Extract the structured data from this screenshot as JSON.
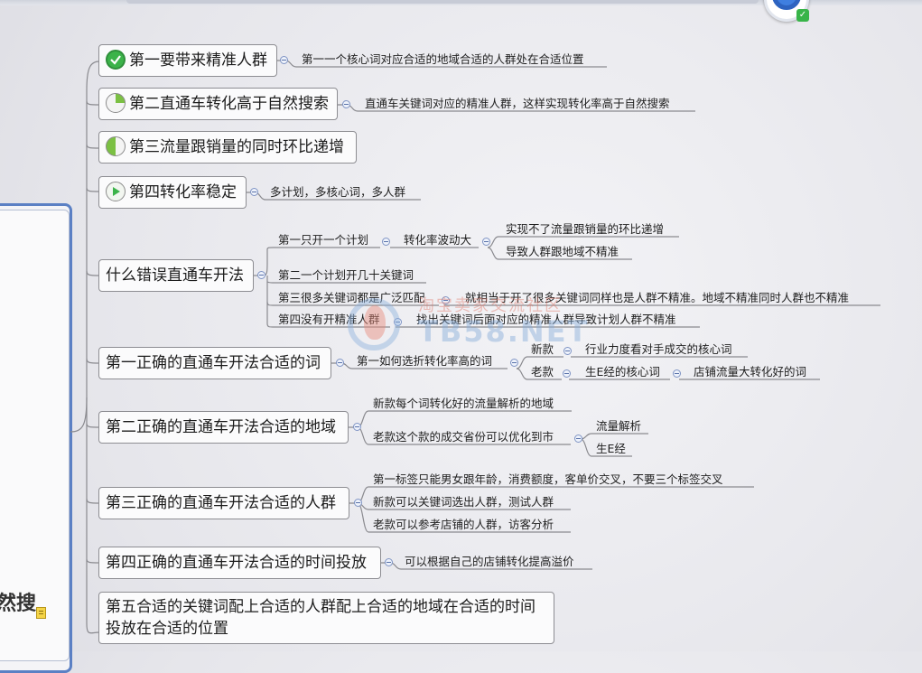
{
  "root": {
    "label_fragment": "然搜"
  },
  "branches": [
    {
      "id": "b1",
      "label": "第一要带来精准人群",
      "icon": "check-icon",
      "children": [
        {
          "label": "第一一个核心词对应合适的地域合适的人群处在合适位置"
        }
      ]
    },
    {
      "id": "b2",
      "label": "第二直通车转化高于自然搜索",
      "icon": "progress-quarter-icon",
      "children": [
        {
          "label": "直通车关键词对应的精准人群，这样实现转化率高于自然搜索"
        }
      ]
    },
    {
      "id": "b3",
      "label": "第三流量跟销量的同时环比递增",
      "icon": "progress-half-icon",
      "children": []
    },
    {
      "id": "b4",
      "label": "第四转化率稳定",
      "icon": "play-icon",
      "children": [
        {
          "label": "多计划，多核心词，多人群"
        }
      ]
    },
    {
      "id": "b5",
      "label": "什么错误直通车开法",
      "children": [
        {
          "label": "第一只开一个计划",
          "children": [
            {
              "label": "转化率波动大",
              "children": [
                {
                  "label": "实现不了流量跟销量的环比递增"
                },
                {
                  "label": "导致人群跟地域不精准"
                }
              ]
            }
          ]
        },
        {
          "label": "第二一个计划开几十关键词"
        },
        {
          "label": "第三很多关键词都是广泛匹配",
          "children": [
            {
              "label": "就相当于开了很多关键词同样也是人群不精准。地域不精准同时人群也不精准"
            }
          ]
        },
        {
          "label": "第四没有开精准人群",
          "children": [
            {
              "label": "找出关键词后面对应的精准人群导致计划人群不精准"
            }
          ]
        }
      ]
    },
    {
      "id": "b6",
      "label": "第一正确的直通车开法合适的词",
      "children": [
        {
          "label": "第一如何选折转化率高的词",
          "children": [
            {
              "label": "新款",
              "children": [
                {
                  "label": "行业力度看对手成交的核心词"
                }
              ]
            },
            {
              "label": "老款",
              "children": [
                {
                  "label": "生E经的核心词",
                  "children": [
                    {
                      "label": "店铺流量大转化好的词"
                    }
                  ]
                }
              ]
            }
          ]
        }
      ]
    },
    {
      "id": "b7",
      "label": "第二正确的直通车开法合适的地域",
      "children": [
        {
          "label": "新款每个词转化好的流量解析的地域"
        },
        {
          "label": "老款这个款的成交省份可以优化到市",
          "children": [
            {
              "label": "流量解析"
            },
            {
              "label": "生E经"
            }
          ]
        }
      ]
    },
    {
      "id": "b8",
      "label": "第三正确的直通车开法合适的人群",
      "children": [
        {
          "label": "第一标签只能男女跟年龄，消费额度，客单价交叉，不要三个标签交叉"
        },
        {
          "label": "新款可以关键词选出人群，测试人群"
        },
        {
          "label": "老款可以参考店铺的人群，访客分析"
        }
      ]
    },
    {
      "id": "b9",
      "label": "第四正确的直通车开法合适的时间投放",
      "children": [
        {
          "label": "可以根据自己的店铺转化提高溢价"
        }
      ]
    },
    {
      "id": "b10",
      "label": "第五合适的关键词配上合适的人群配上合适的地域在合适的时间",
      "label2": "投放在合适的位置",
      "children": []
    }
  ],
  "watermark": {
    "cn": "淘宝卖家交流社区",
    "en": "TB58.NET"
  },
  "colors": {
    "root_border": "#5b80c4",
    "check": "#3cb34a",
    "progress": "#7bc043",
    "play": "#3cb34a"
  }
}
